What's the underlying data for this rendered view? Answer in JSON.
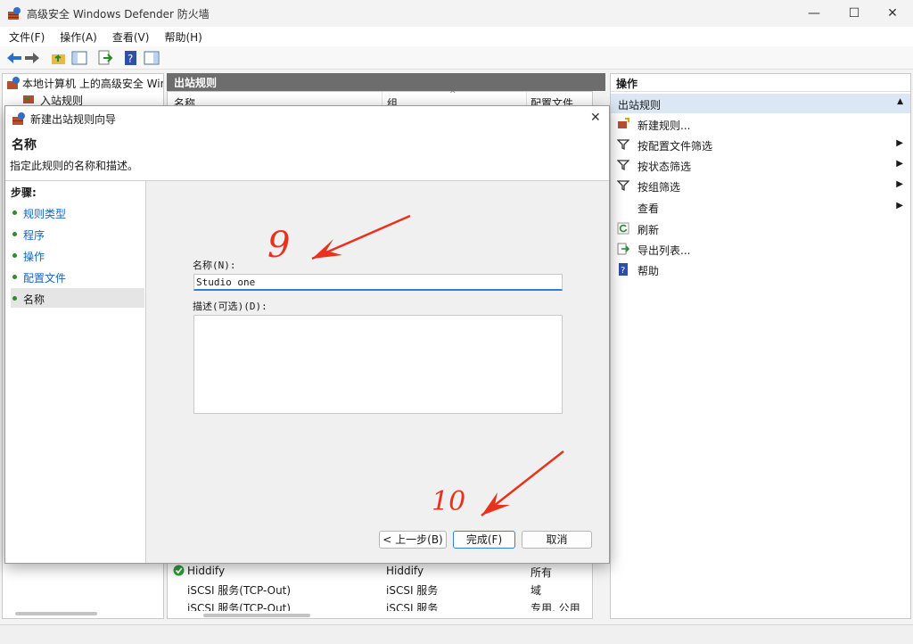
{
  "window": {
    "title": "高级安全 Windows Defender 防火墙",
    "minimize": "—",
    "maximize": "☐",
    "close": "✕"
  },
  "menu": [
    "文件(F)",
    "操作(A)",
    "查看(V)",
    "帮助(H)"
  ],
  "tree": {
    "root": "本地计算机 上的高级安全 Windo",
    "inbound": "入站规则"
  },
  "middle": {
    "title": "出站规则",
    "columns": [
      "名称",
      "组",
      "配置文件"
    ],
    "rows": [
      {
        "name": "Hiddify",
        "group": "Hiddify",
        "profile": "所有"
      },
      {
        "name": "iSCSI 服务(TCP-Out)",
        "group": "iSCSI 服务",
        "profile": "域"
      },
      {
        "name": "iSCSI 服务(TCP-Out)",
        "group": "iSCSI 服务",
        "profile": "专用, 公用"
      }
    ]
  },
  "actions": {
    "title": "操作",
    "section": "出站规则",
    "items": [
      {
        "label": "新建规则...",
        "icon": "new-rule-icon",
        "submenu": false
      },
      {
        "label": "按配置文件筛选",
        "icon": "filter-icon",
        "submenu": true
      },
      {
        "label": "按状态筛选",
        "icon": "filter-icon",
        "submenu": true
      },
      {
        "label": "按组筛选",
        "icon": "filter-icon",
        "submenu": true
      },
      {
        "label": "查看",
        "icon": "",
        "submenu": true
      },
      {
        "label": "刷新",
        "icon": "refresh-icon",
        "submenu": false
      },
      {
        "label": "导出列表...",
        "icon": "export-icon",
        "submenu": false
      },
      {
        "label": "帮助",
        "icon": "help-icon",
        "submenu": false
      }
    ]
  },
  "dialog": {
    "title": "新建出站规则向导",
    "heading": "名称",
    "description": "指定此规则的名称和描述。",
    "steps_label": "步骤:",
    "steps": [
      "规则类型",
      "程序",
      "操作",
      "配置文件",
      "名称"
    ],
    "name_label": "名称(N):",
    "name_value": "Studio one",
    "desc_label": "描述(可选)(D):",
    "desc_value": "",
    "back_button": "< 上一步(B)",
    "finish_button": "完成(F)",
    "cancel_button": "取消",
    "close": "✕"
  },
  "annotations": {
    "mark_9": "9",
    "mark_10": "10",
    "color": "#e8321e"
  }
}
